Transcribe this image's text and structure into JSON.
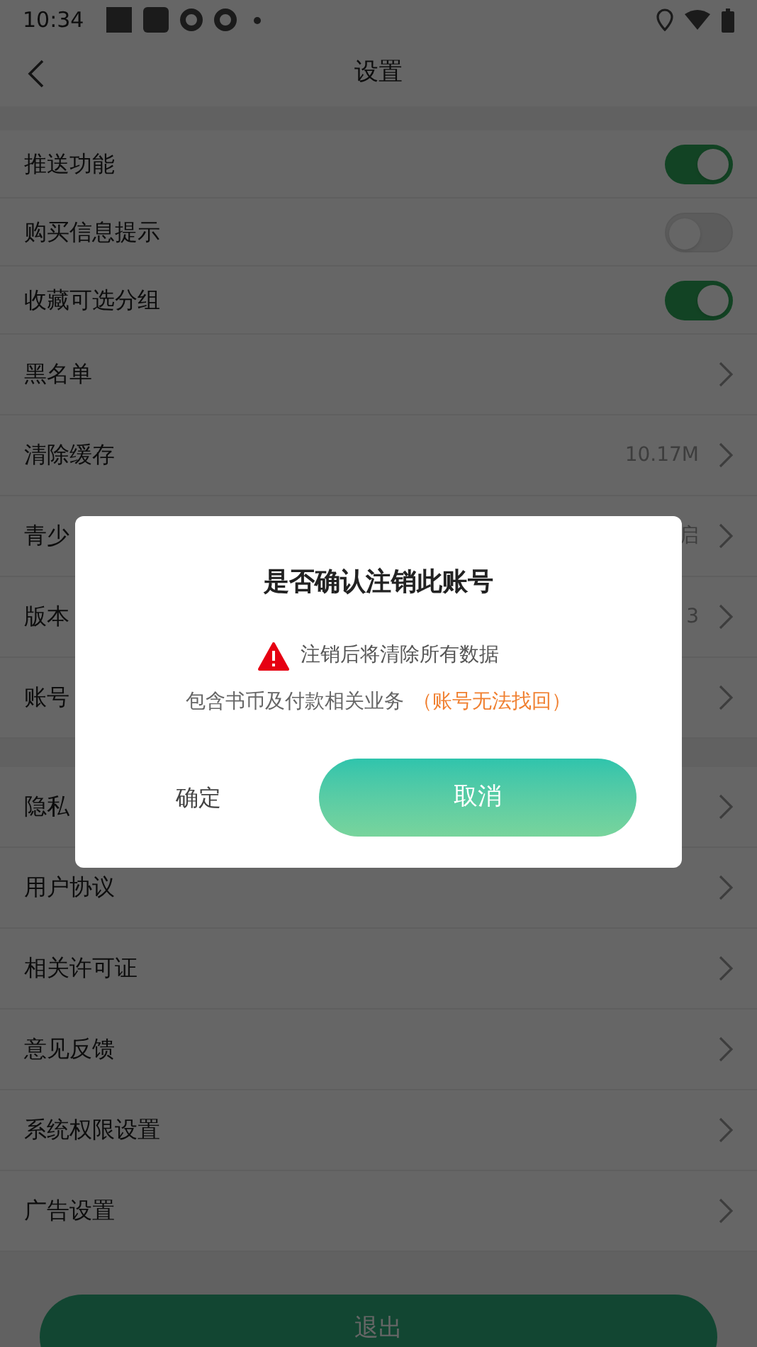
{
  "status_bar": {
    "time": "10:34"
  },
  "header": {
    "title": "设置"
  },
  "groups": [
    {
      "items": [
        {
          "kind": "toggle",
          "label": "推送功能",
          "on": true
        },
        {
          "kind": "toggle",
          "label": "购买信息提示",
          "on": false
        },
        {
          "kind": "toggle",
          "label": "收藏可选分组",
          "on": true
        },
        {
          "kind": "link",
          "label": "黑名单"
        },
        {
          "kind": "link",
          "label": "清除缓存",
          "value": "10.17M"
        },
        {
          "kind": "link",
          "label": "青少",
          "value": "启"
        },
        {
          "kind": "link",
          "label": "版本",
          "value": "3"
        },
        {
          "kind": "link",
          "label": "账号"
        }
      ]
    },
    {
      "items": [
        {
          "kind": "link",
          "label": "隐私"
        },
        {
          "kind": "link",
          "label": "用户协议"
        },
        {
          "kind": "link",
          "label": "相关许可证"
        },
        {
          "kind": "link",
          "label": "意见反馈"
        },
        {
          "kind": "link",
          "label": "系统权限设置"
        },
        {
          "kind": "link",
          "label": "广告设置"
        }
      ]
    }
  ],
  "logout_button": "退出",
  "dialog": {
    "title": "是否确认注销此账号",
    "warning": "注销后将清除所有数据",
    "note": "包含书币及付款相关业务",
    "note_highlight": "（账号无法找回）",
    "confirm_button": "确定",
    "cancel_button": "取消"
  }
}
